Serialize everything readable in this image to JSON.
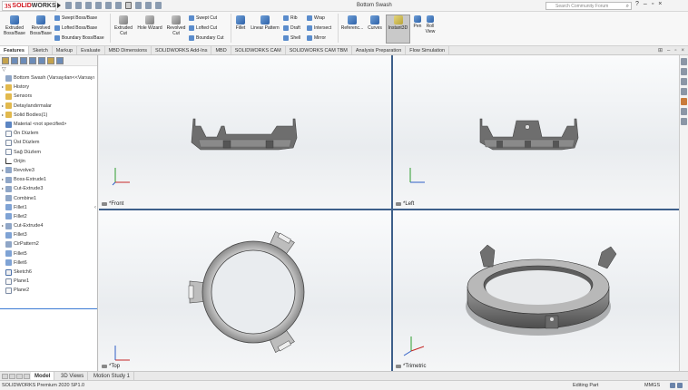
{
  "app": {
    "logo_ds": "3S",
    "logo_name": "SOLID",
    "logo_name_bold": "WORKS",
    "document_title": "Bottom Swash",
    "search_placeholder": "Search Community Forum"
  },
  "ribbon": {
    "extruded_boss": [
      "Extruded",
      "Boss/Base"
    ],
    "revolved_boss": [
      "Revolved",
      "Boss/Base"
    ],
    "swept_boss": "Swept Boss/Base",
    "lofted_boss": "Lofted Boss/Base",
    "boundary_boss": "Boundary Boss/Base",
    "extruded_cut": [
      "Extruded",
      "Cut"
    ],
    "hole_wizard": "Hole Wizard",
    "revolved_cut": [
      "Revolved",
      "Cut"
    ],
    "swept_cut": "Swept Cut",
    "lofted_cut": "Lofted Cut",
    "boundary_cut": "Boundary Cut",
    "fillet": "Fillet",
    "linear_pattern": "Linear Pattern",
    "rib": "Rib",
    "draft": "Draft",
    "shell": "Shell",
    "wrap": "Wrap",
    "intersect": "Intersect",
    "mirror": "Mirror",
    "reference": "Referenc...",
    "curves": "Curves",
    "instant3d": "Instant3D",
    "pen": "Pen",
    "roll_view": [
      "Roll",
      "View"
    ]
  },
  "tabs": [
    "Features",
    "Sketch",
    "Markup",
    "Evaluate",
    "MBD Dimensions",
    "SOLIDWORKS Add-Ins",
    "MBD",
    "SOLIDWORKS CAM",
    "SOLIDWORKS CAM TBM",
    "Analysis Preparation",
    "Flow Simulation"
  ],
  "tree": {
    "items": [
      {
        "label": "Bottom Swash  (Varsayılan<<Varsayı",
        "icon": "part-icon",
        "exp": ""
      },
      {
        "label": "History",
        "icon": "history-icon",
        "exp": "▸"
      },
      {
        "label": "Sensors",
        "icon": "sensor-icon",
        "exp": ""
      },
      {
        "label": "Detaylandırmalar",
        "icon": "annotations-icon",
        "exp": "▸"
      },
      {
        "label": "Solid Bodies(1)",
        "icon": "solid-bodies-icon",
        "exp": "▸"
      },
      {
        "label": "Material <not specified>",
        "icon": "material-icon",
        "exp": ""
      },
      {
        "label": "Ön Düzlem",
        "icon": "plane-icon",
        "exp": ""
      },
      {
        "label": "Üst Düzlem",
        "icon": "plane-icon",
        "exp": ""
      },
      {
        "label": "Sağ Düzlem",
        "icon": "plane-icon",
        "exp": ""
      },
      {
        "label": "Orijin",
        "icon": "origin-icon",
        "exp": ""
      },
      {
        "label": "Revolve3",
        "icon": "revolve-icon",
        "exp": "▸"
      },
      {
        "label": "Boss-Extrude1",
        "icon": "extrude-icon",
        "exp": "▸"
      },
      {
        "label": "Cut-Extrude3",
        "icon": "cut-extrude-icon",
        "exp": "▸"
      },
      {
        "label": "Combine1",
        "icon": "combine-icon",
        "exp": ""
      },
      {
        "label": "Fillet1",
        "icon": "fillet-icon",
        "exp": ""
      },
      {
        "label": "Fillet2",
        "icon": "fillet-icon",
        "exp": ""
      },
      {
        "label": "Cut-Extrude4",
        "icon": "cut-extrude-icon",
        "exp": "▸"
      },
      {
        "label": "Fillet3",
        "icon": "fillet-icon",
        "exp": ""
      },
      {
        "label": "CirPattern2",
        "icon": "pattern-icon",
        "exp": ""
      },
      {
        "label": "Fillet5",
        "icon": "fillet-icon",
        "exp": ""
      },
      {
        "label": "Fillet6",
        "icon": "fillet-icon",
        "exp": ""
      },
      {
        "label": "Sketch6",
        "icon": "sketch-icon",
        "exp": ""
      },
      {
        "label": "Plane1",
        "icon": "plane-icon",
        "exp": ""
      },
      {
        "label": "Plane2",
        "icon": "plane-icon",
        "exp": ""
      }
    ]
  },
  "viewports": {
    "front": "*Front",
    "left": "*Left",
    "top": "*Top",
    "trimetric": "*Trimetric"
  },
  "bottom_tabs": [
    "Model",
    "3D Views",
    "Motion Study 1"
  ],
  "status": {
    "version": "SOLIDWORKS Premium 2020 SP1.0",
    "mode": "Editing Part",
    "units": "MMGS"
  },
  "colors": {
    "brand_red": "#d0121b",
    "viewport_divider": "#3d5f8a",
    "selection_blue": "#3b7bd4"
  }
}
